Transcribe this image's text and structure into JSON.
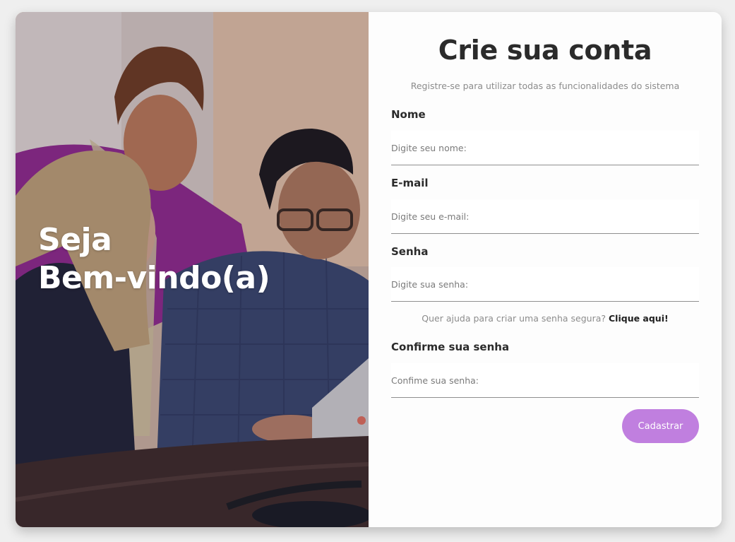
{
  "hero": {
    "title_line1": "Seja",
    "title_line2": "Bem-vindo(a)"
  },
  "form": {
    "title": "Crie sua conta",
    "subtitle": "Registre-se para utilizar todas as funcionalidades do sistema",
    "fields": {
      "name": {
        "label": "Nome",
        "placeholder": "Digite seu nome:"
      },
      "email": {
        "label": "E-mail",
        "placeholder": "Digite seu e-mail:"
      },
      "password": {
        "label": "Senha",
        "placeholder": "Digite sua senha:"
      },
      "confirm": {
        "label": "Confirme sua senha",
        "placeholder": "Confime sua senha:"
      }
    },
    "help_text": "Quer ajuda para criar uma senha segura?",
    "help_link": "Clique aqui!",
    "submit_label": "Cadastrar"
  },
  "colors": {
    "accent": "#c07fdf",
    "title_text": "#2b2b2b",
    "muted_text": "#8c8c8c",
    "background": "#efefef"
  }
}
